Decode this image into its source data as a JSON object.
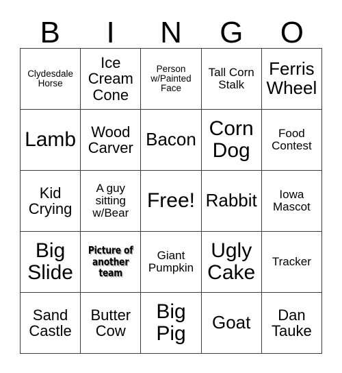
{
  "card": {
    "title": "BINGO",
    "header": [
      {
        "letter": "B"
      },
      {
        "letter": "I"
      },
      {
        "letter": "N"
      },
      {
        "letter": "G"
      },
      {
        "letter": "O"
      }
    ],
    "rows": [
      [
        {
          "text": "Clydesdale Horse",
          "size": "fs-xs",
          "style": "normal",
          "free": false
        },
        {
          "text": "Ice Cream Cone",
          "size": "fs-md",
          "style": "normal",
          "free": false
        },
        {
          "text": "Person w/Painted Face",
          "size": "fs-xs",
          "style": "normal",
          "free": false
        },
        {
          "text": "Tall Corn Stalk",
          "size": "fs-sm",
          "style": "normal",
          "free": false
        },
        {
          "text": "Ferris Wheel",
          "size": "fs-lg",
          "style": "normal",
          "free": false
        }
      ],
      [
        {
          "text": "Lamb",
          "size": "fs-xl",
          "style": "normal",
          "free": false
        },
        {
          "text": "Wood Carver",
          "size": "fs-md",
          "style": "normal",
          "free": false
        },
        {
          "text": "Bacon",
          "size": "fs-lg",
          "style": "normal",
          "free": false
        },
        {
          "text": "Corn Dog",
          "size": "fs-xl",
          "style": "normal",
          "free": false
        },
        {
          "text": "Food Contest",
          "size": "fs-sm",
          "style": "normal",
          "free": false
        }
      ],
      [
        {
          "text": "Kid Crying",
          "size": "fs-md",
          "style": "normal",
          "free": false
        },
        {
          "text": "A guy sitting w/Bear",
          "size": "fs-sm",
          "style": "normal",
          "free": false
        },
        {
          "text": "Free!",
          "size": "fs-xl",
          "style": "normal",
          "free": true
        },
        {
          "text": "Rabbit",
          "size": "fs-lg",
          "style": "normal",
          "free": false
        },
        {
          "text": "Iowa Mascot",
          "size": "fs-sm",
          "style": "normal",
          "free": false
        }
      ],
      [
        {
          "text": "Big Slide",
          "size": "fs-xl",
          "style": "normal",
          "free": false
        },
        {
          "text": "Picture of another team",
          "size": "fs-xs",
          "style": "stamp",
          "free": false
        },
        {
          "text": "Giant Pumpkin",
          "size": "fs-sm",
          "style": "normal",
          "free": false
        },
        {
          "text": "Ugly Cake",
          "size": "fs-xl",
          "style": "normal",
          "free": false
        },
        {
          "text": "Tracker",
          "size": "fs-sm",
          "style": "normal",
          "free": false
        }
      ],
      [
        {
          "text": "Sand Castle",
          "size": "fs-md",
          "style": "normal",
          "free": false
        },
        {
          "text": "Butter Cow",
          "size": "fs-md",
          "style": "normal",
          "free": false
        },
        {
          "text": "Big Pig",
          "size": "fs-xl",
          "style": "normal",
          "free": false
        },
        {
          "text": "Goat",
          "size": "fs-lg",
          "style": "normal",
          "free": false
        },
        {
          "text": "Dan Tauke",
          "size": "fs-md",
          "style": "normal",
          "free": false
        }
      ]
    ],
    "colors": {
      "background": "#ffffff",
      "text": "#000000",
      "border": "#3a3a3a",
      "stamp_shadow": "#b9b9b9"
    }
  }
}
